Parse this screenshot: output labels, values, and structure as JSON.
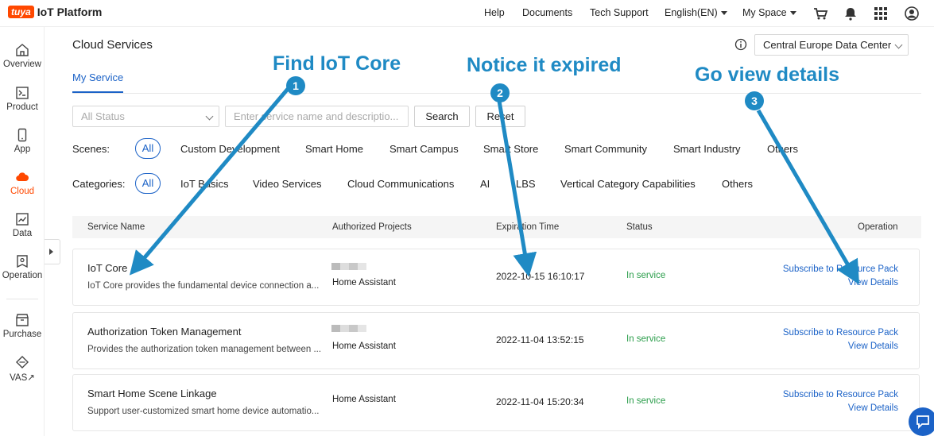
{
  "topbar": {
    "logo_badge": "tuya",
    "logo_text": "IoT Platform",
    "nav": [
      "Help",
      "Documents",
      "Tech Support",
      "English(EN)",
      "My Space"
    ],
    "icons": [
      "cart-icon",
      "bell-icon",
      "grid-icon",
      "user-icon"
    ]
  },
  "sidebar": {
    "items": [
      {
        "label": "Overview",
        "icon": "home-icon"
      },
      {
        "label": "Product",
        "icon": "terminal-icon"
      },
      {
        "label": "App",
        "icon": "phone-icon"
      },
      {
        "label": "Cloud",
        "icon": "cloud-icon",
        "active": true
      },
      {
        "label": "Data",
        "icon": "chart-icon"
      },
      {
        "label": "Operation",
        "icon": "badge-icon"
      },
      {
        "label": "Purchase",
        "icon": "box-icon"
      },
      {
        "label": "VAS",
        "icon": "diamond-icon",
        "suffix": "↗"
      }
    ]
  },
  "main": {
    "title": "Cloud Services",
    "region": "Central Europe Data Center",
    "tab": "My Service",
    "filters": {
      "status_placeholder": "All Status",
      "search_placeholder": "Enter service name and descriptio...",
      "search_button": "Search",
      "reset_button": "Reset"
    },
    "scenes": {
      "label": "Scenes:",
      "items": [
        "All",
        "Custom Development",
        "Smart Home",
        "Smart Campus",
        "Smart Store",
        "Smart Community",
        "Smart Industry",
        "Others"
      ]
    },
    "categories": {
      "label": "Categories:",
      "items": [
        "All",
        "IoT Basics",
        "Video Services",
        "Cloud Communications",
        "AI",
        "LBS",
        "Vertical Category Capabilities",
        "Others"
      ]
    },
    "table": {
      "headers": [
        "Service Name",
        "Authorized Projects",
        "Expiration Time",
        "Status",
        "Operation"
      ],
      "rows": [
        {
          "name": "IoT Core",
          "desc": "IoT Core provides the fundamental device connection a...",
          "project": "Home Assistant",
          "expiration": "2022-10-15 16:10:17",
          "status": "In service",
          "op1": "Subscribe to Resource Pack",
          "op2": "View Details"
        },
        {
          "name": "Authorization Token Management",
          "desc": "Provides the authorization token management between ...",
          "project": "Home Assistant",
          "expiration": "2022-11-04 13:52:15",
          "status": "In service",
          "op1": "Subscribe to Resource Pack",
          "op2": "View Details"
        },
        {
          "name": "Smart Home Scene Linkage",
          "desc": "Support user-customized smart home device automatio...",
          "project": "Home Assistant",
          "expiration": "2022-11-04 15:20:34",
          "status": "In service",
          "op1": "Subscribe to Resource Pack",
          "op2": "View Details"
        }
      ]
    }
  },
  "annotations": [
    {
      "num": "1",
      "text": "Find IoT Core"
    },
    {
      "num": "2",
      "text": "Notice it expired"
    },
    {
      "num": "3",
      "text": "Go view details"
    }
  ],
  "colors": {
    "brand": "#ff4800",
    "link": "#1b62c7",
    "annotation": "#1f8ac4",
    "status_ok": "#2a9d4a"
  }
}
